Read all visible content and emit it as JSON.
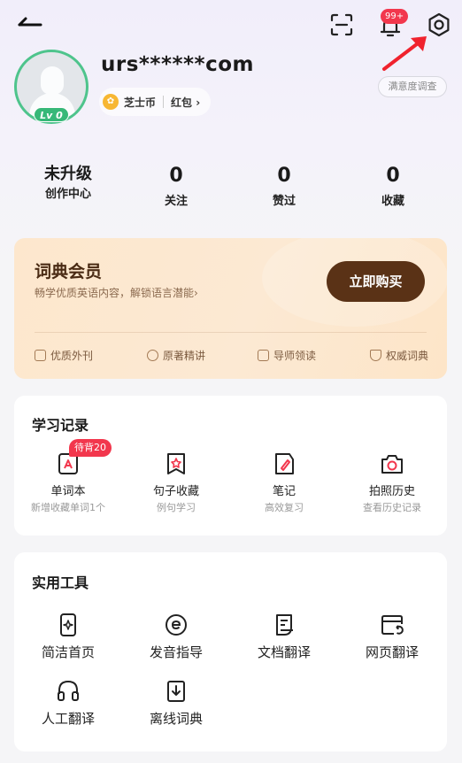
{
  "header": {
    "notification_badge": "99+"
  },
  "profile": {
    "username": "urs******com",
    "level": "Lv 0",
    "coin_label": "芝士币",
    "hongbao_label": "红包 ›",
    "survey_label": "满意度调查"
  },
  "stats": [
    {
      "value": "未升级",
      "label": "创作中心"
    },
    {
      "value": "0",
      "label": "关注"
    },
    {
      "value": "0",
      "label": "赞过"
    },
    {
      "value": "0",
      "label": "收藏"
    }
  ],
  "vip": {
    "title": "词典会员",
    "subtitle": "畅学优质英语内容，解锁语言潜能›",
    "buy_label": "立即购买",
    "features": [
      "优质外刊",
      "原著精讲",
      "导师领读",
      "权威词典"
    ]
  },
  "study": {
    "title": "学习记录",
    "items": [
      {
        "label": "单词本",
        "sub": "新增收藏单词1个",
        "badge": "待背20",
        "icon": "wordbook-icon"
      },
      {
        "label": "句子收藏",
        "sub": "例句学习",
        "icon": "sentence-icon"
      },
      {
        "label": "笔记",
        "sub": "高效复习",
        "icon": "note-icon"
      },
      {
        "label": "拍照历史",
        "sub": "查看历史记录",
        "icon": "camera-icon"
      }
    ]
  },
  "tools": {
    "title": "实用工具",
    "items": [
      {
        "label": "简洁首页",
        "icon": "simple-home-icon"
      },
      {
        "label": "发音指导",
        "icon": "pronunciation-icon"
      },
      {
        "label": "文档翻译",
        "icon": "doc-translate-icon"
      },
      {
        "label": "网页翻译",
        "icon": "web-translate-icon"
      },
      {
        "label": "人工翻译",
        "icon": "headset-icon"
      },
      {
        "label": "离线词典",
        "icon": "offline-dict-icon"
      }
    ]
  },
  "colors": {
    "accent_red": "#f2374d",
    "level_green": "#37b878",
    "vip_brown": "#5a3216"
  }
}
